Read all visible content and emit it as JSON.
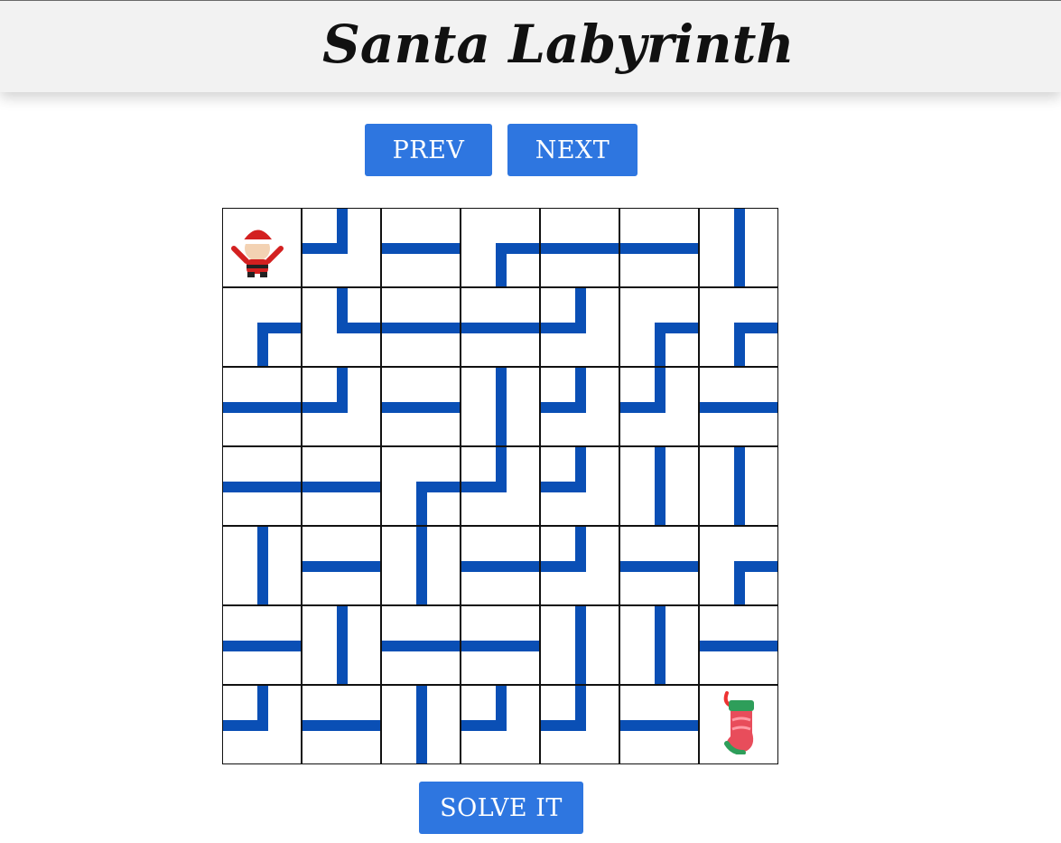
{
  "header": {
    "title": "Santa Labyrinth"
  },
  "controls": {
    "prev_label": "PREV",
    "next_label": "NEXT",
    "solve_label": "SOLVE IT"
  },
  "board": {
    "rows": 7,
    "cols": 7,
    "pipe_color": "#0a4fb5",
    "start_icon": "santa-icon",
    "goal_icon": "stocking-icon",
    "tiles": [
      [
        "start",
        "corner-nw",
        "straight-h",
        "corner-se",
        "straight-h",
        "straight-h",
        "straight-v"
      ],
      [
        "corner-se",
        "corner-ne",
        "straight-h",
        "straight-h",
        "corner-nw",
        "corner-se",
        "corner-se"
      ],
      [
        "straight-h",
        "corner-nw",
        "straight-h",
        "straight-v",
        "corner-nw",
        "corner-nw",
        "straight-h"
      ],
      [
        "straight-h",
        "straight-h",
        "corner-se",
        "corner-nw",
        "corner-nw",
        "straight-v",
        "straight-v"
      ],
      [
        "straight-v",
        "straight-h",
        "straight-v",
        "straight-h",
        "corner-nw",
        "straight-h",
        "corner-se"
      ],
      [
        "straight-h",
        "straight-v",
        "straight-h",
        "straight-h",
        "straight-v",
        "straight-v",
        "straight-h"
      ],
      [
        "corner-nw",
        "straight-h",
        "straight-v",
        "corner-nw",
        "corner-nw",
        "straight-h",
        "goal"
      ]
    ]
  },
  "colors": {
    "button_bg": "#2e76e0",
    "header_bg": "#f2f2f2"
  }
}
